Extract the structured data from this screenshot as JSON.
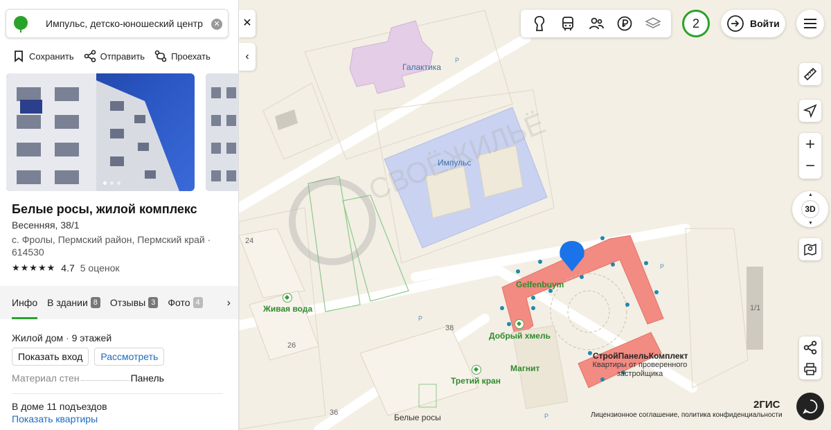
{
  "search": {
    "query": "Импульс, детско-юношеский центр",
    "clear_icon": "x-circle-icon"
  },
  "actions": [
    {
      "label": "Сохранить",
      "icon": "bookmark-icon"
    },
    {
      "label": "Отправить",
      "icon": "share-icon"
    },
    {
      "label": "Проехать",
      "icon": "route-icon"
    }
  ],
  "photos": {
    "count_shown": 2
  },
  "place": {
    "title": "Белые росы, жилой комплекс",
    "address": "Весенняя, 38/1",
    "locality": "с. Фролы, Пермский район, Пермский край · 614530",
    "rating_value": "4.7",
    "rating_count": "5 оценок",
    "stars": 4.7
  },
  "tabs": [
    {
      "label": "Инфо",
      "badge": ""
    },
    {
      "label": "В здании",
      "badge": "8"
    },
    {
      "label": "Отзывы",
      "badge": "3"
    },
    {
      "label": "Фото",
      "badge": "4"
    }
  ],
  "info": {
    "building_type": "Жилой дом",
    "floors": "9 этажей",
    "show_entrance": "Показать вход",
    "view": "Рассмотреть",
    "material_label": "Материал стен",
    "material_value": "Панель",
    "entrances": "В доме 11 подъездов",
    "show_apartments": "Показать квартиры"
  },
  "map": {
    "labels": {
      "galaxy": "Галактика",
      "impulse": "Импульс",
      "gelfenbuym": "Gelfenbuym",
      "zhivaya_voda": "Живая вода",
      "dobry_khmel": "Добрый хмель",
      "magnit": "Магнит",
      "treti_kran": "Третий кран",
      "stroy_panel": "СтройПанельКомплект",
      "stroy_panel_sub": "Квартиры от проверенного застройщика",
      "belye_rosy": "Белые росы",
      "num_24": "24",
      "num_26": "26",
      "num_38": "38",
      "num_36": "36",
      "num_1_1": "1/1"
    },
    "parking_symbol": "P",
    "watermark": "СВОЁЖИЛЬЁ"
  },
  "controls": {
    "counter": "2",
    "login": "Войти",
    "compass_n": "▲",
    "compass_s": "▼",
    "label_3d": "3D",
    "brand": "2ГИС",
    "license": "Лицензионное соглашение, политика конфиденциальности"
  },
  "colors": {
    "accent_green": "#29a329",
    "link_blue": "#1b6bc2",
    "building_highlight": "#f28b82",
    "pin_blue": "#1a73e8"
  }
}
